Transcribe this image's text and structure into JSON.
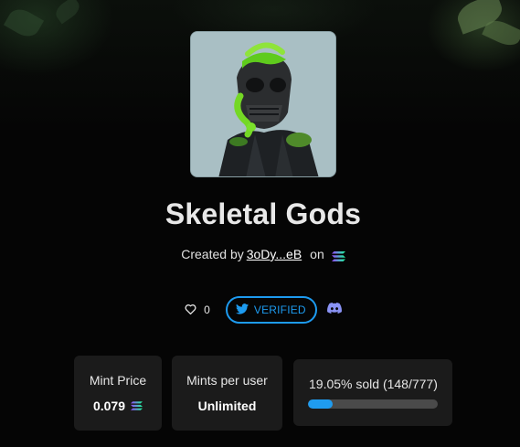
{
  "collection": {
    "title": "Skeletal Gods",
    "created_by_label": "Created by",
    "creator_address": "3oDy...eB",
    "on_label": "on",
    "chain_icon": "solana-icon"
  },
  "social": {
    "likes_count": "0",
    "verified_label": "VERIFIED",
    "twitter_icon": "twitter-icon",
    "discord_icon": "discord-icon"
  },
  "stats": {
    "mint_price_label": "Mint Price",
    "mint_price_value": "0.079",
    "mints_per_user_label": "Mints per user",
    "mints_per_user_value": "Unlimited",
    "sold_label": "19.05% sold (148/777)",
    "sold_fraction": 0.1905
  },
  "colors": {
    "accent_blue": "#1d9bf0",
    "card_bg": "#1b1b1b",
    "page_bg": "#050505"
  }
}
